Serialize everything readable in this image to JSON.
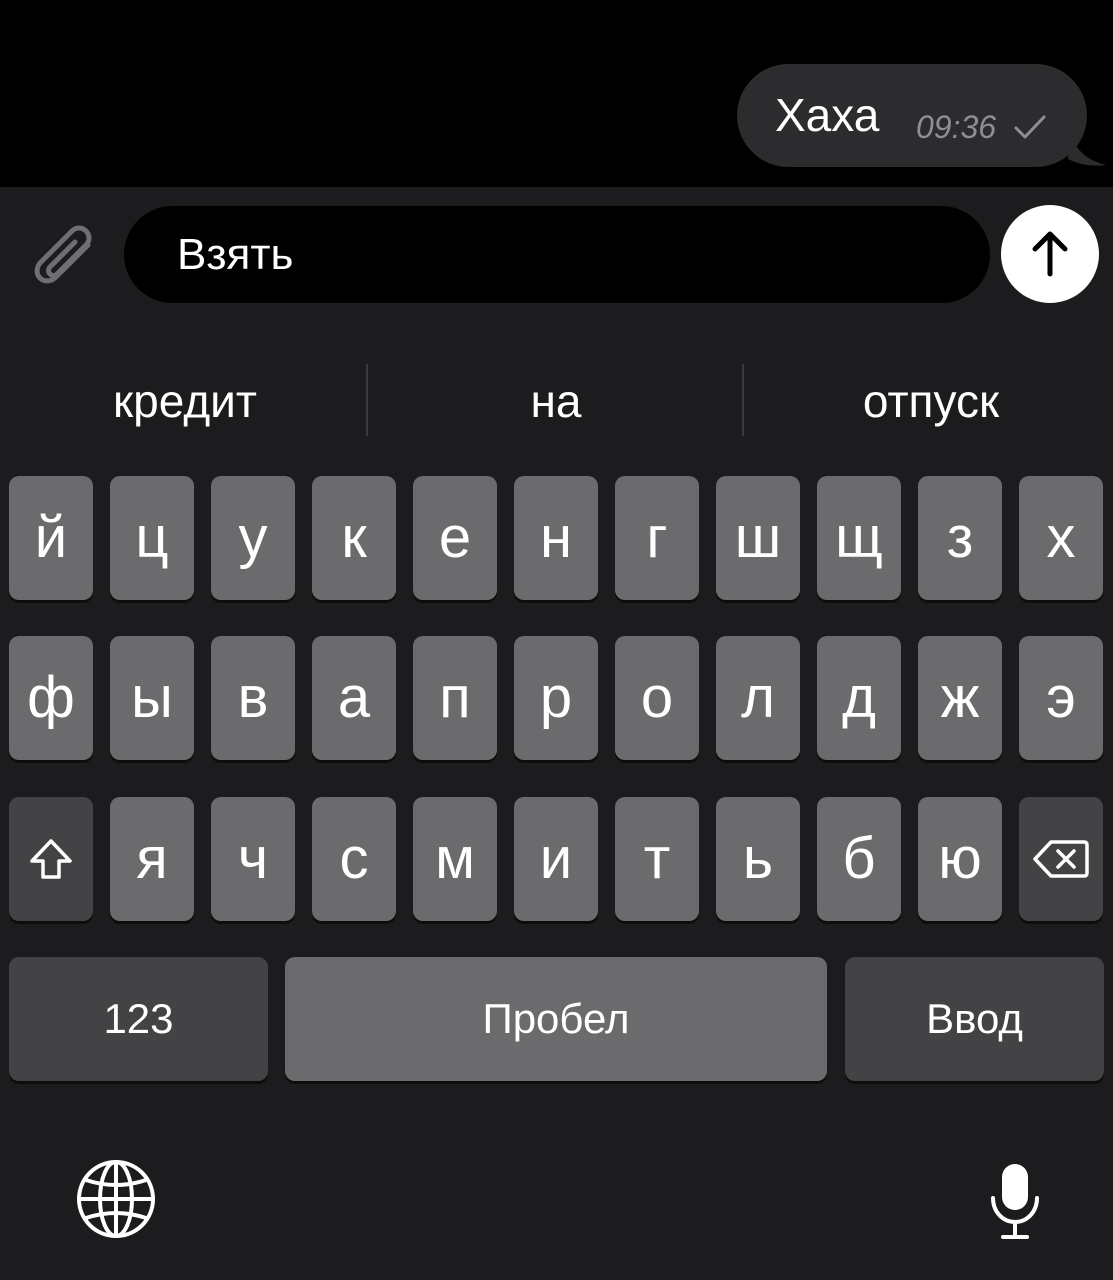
{
  "chat": {
    "message_text": "Хаха",
    "message_time": "09:36"
  },
  "input": {
    "text": "Взять"
  },
  "suggestions": [
    "кредит",
    "на",
    "отпуск"
  ],
  "keyboard": {
    "row1": [
      "й",
      "ц",
      "у",
      "к",
      "е",
      "н",
      "г",
      "ш",
      "щ",
      "з",
      "х"
    ],
    "row2": [
      "ф",
      "ы",
      "в",
      "а",
      "п",
      "р",
      "о",
      "л",
      "д",
      "ж",
      "э"
    ],
    "row3": [
      "я",
      "ч",
      "с",
      "м",
      "и",
      "т",
      "ь",
      "б",
      "ю"
    ],
    "numbers_label": "123",
    "space_label": "Пробел",
    "return_label": "Ввод"
  },
  "icons": {
    "attach": "paperclip-icon",
    "send": "arrow-up-icon",
    "shift": "shift-icon",
    "backspace": "backspace-icon",
    "globe": "globe-icon",
    "mic": "microphone-icon",
    "read": "checkmark-icon"
  },
  "colors": {
    "background": "#000000",
    "bar": "#1c1c1e",
    "bubble": "#2c2c2e",
    "key": "#6b6b6d",
    "key_dark": "#434345",
    "send_button": "#ffffff"
  }
}
